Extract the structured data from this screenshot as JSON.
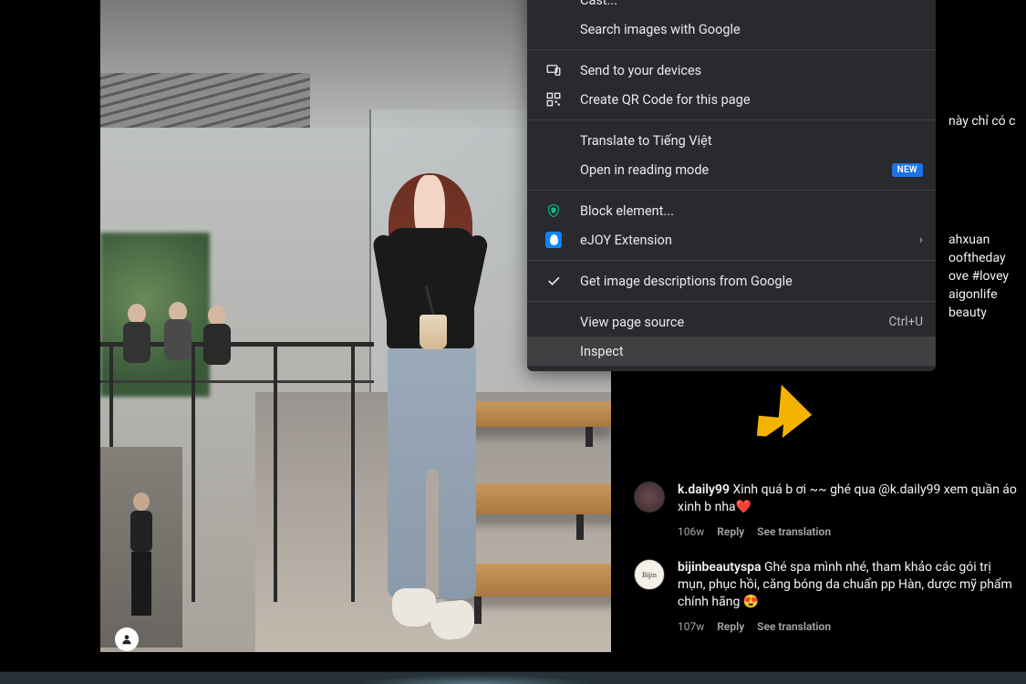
{
  "context_menu": {
    "items": {
      "cast": "Cast...",
      "search_images": "Search images with Google",
      "send_devices": "Send to your devices",
      "create_qr": "Create QR Code for this page",
      "translate": "Translate to Tiếng Việt",
      "reading_mode": "Open in reading mode",
      "reading_mode_badge": "NEW",
      "block_element": "Block element...",
      "ejoy": "eJOY Extension",
      "image_descriptions": "Get image descriptions from Google",
      "view_source": "View page source",
      "view_source_shortcut": "Ctrl+U",
      "inspect": "Inspect"
    }
  },
  "caption_fragments": {
    "line1": "này chỉ có c",
    "line2": "ahxuan",
    "line3": "ooftheday",
    "line4": "ove #lovey",
    "line5": "aigonlife",
    "line6": "beauty"
  },
  "comments": [
    {
      "user": "k.daily99",
      "text": " Xinh quá b ơi ~~ ghé qua @k.daily99 xem quần áo xinh b nha",
      "emoji": "❤️",
      "age": "106w",
      "reply": "Reply",
      "translate": "See translation",
      "avatar_label": ""
    },
    {
      "user": "bijinbeautyspa",
      "text": " Ghé spa mình nhé, tham khảo các gói trị mụn, phục hồi, căng bóng da chuẩn pp Hàn, dược mỹ phẩm chính hãng ",
      "emoji": "😍",
      "age": "107w",
      "reply": "Reply",
      "translate": "See translation",
      "avatar_label": "Bijin"
    }
  ]
}
